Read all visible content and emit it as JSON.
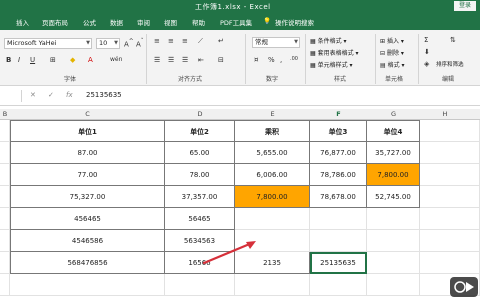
{
  "titlebar": {
    "title": "工作簿1.xlsx  -  Excel",
    "login": "登录"
  },
  "menubar": {
    "tabs": [
      "插入",
      "页面布局",
      "公式",
      "数据",
      "审阅",
      "视图",
      "帮助",
      "PDF工具集",
      "操作说明搜索"
    ]
  },
  "ribbon": {
    "font_name": "Microsoft YaHei",
    "font_size": "10",
    "number_format": "常规",
    "cond_format": "条件格式",
    "table_format": "套用表格格式",
    "cell_style": "单元格样式",
    "insert": "插入",
    "delete": "删除",
    "format": "格式",
    "sort_filter": "排序和筛选",
    "group_font": "字体",
    "group_align": "对齐方式",
    "group_number": "数字",
    "group_style": "样式",
    "group_cells": "单元格",
    "group_edit": "编辑"
  },
  "formula_bar": {
    "fx": "fx",
    "cancel": "✕",
    "confirm": "✓",
    "value": "25135635"
  },
  "columns": {
    "b": "B",
    "c": "C",
    "d": "D",
    "e": "E",
    "f": "F",
    "g": "G",
    "h": "H"
  },
  "table": {
    "headers": [
      "单位1",
      "单位2",
      "乘积",
      "单位3",
      "单位4"
    ],
    "rows": [
      [
        "87.00",
        "65.00",
        "5,655.00",
        "76,877.00",
        "35,727.00"
      ],
      [
        "77.00",
        "78.00",
        "6,006.00",
        "78,786.00",
        "7,800.00"
      ],
      [
        "75,327.00",
        "37,357.00",
        "7,800.00",
        "78,678.00",
        "52,745.00"
      ],
      [
        "456465",
        "56465",
        "",
        "",
        ""
      ],
      [
        "4546586",
        "5634563",
        "",
        "",
        ""
      ],
      [
        "568476856",
        "16566",
        "2135",
        "25135635",
        ""
      ]
    ]
  },
  "colors": {
    "accent": "#217346",
    "highlight": "#ffa500",
    "arrow": "#d6303a"
  }
}
